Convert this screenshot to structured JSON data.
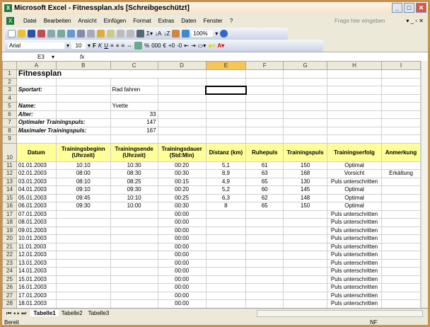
{
  "window": {
    "title": "Microsoft Excel - Fitnessplan.xls  [Schreibgeschützt]"
  },
  "menu": [
    "Datei",
    "Bearbeiten",
    "Ansicht",
    "Einfügen",
    "Format",
    "Extras",
    "Daten",
    "Fenster",
    "?"
  ],
  "help_placeholder": "Frage hier eingeben",
  "toolbar": {
    "zoom": "100%",
    "font": "Arial",
    "size": "10",
    "bold": "F",
    "italic": "K",
    "underline": "U",
    "percent": "%",
    "thousands": "000",
    "euro": "€"
  },
  "formula_bar": {
    "cell_ref": "E3",
    "fx": "fx",
    "value": ""
  },
  "columns": [
    "A",
    "B",
    "C",
    "D",
    "E",
    "F",
    "G",
    "H",
    "I"
  ],
  "selected_column": "E",
  "sheet": {
    "title": "Fitnessplan",
    "sportart_label": "Sportart:",
    "sportart": "Rad fahren",
    "name_label": "Name:",
    "name": "Yvette",
    "alter_label": "Alter:",
    "alter": "33",
    "opt_label": "Optimaler Trainingspuls:",
    "opt": "147",
    "max_label": "Maximaler Trainingspuls:",
    "max": "167",
    "headers": [
      "Datum",
      "Trainingsbeginn (Uhrzeit)",
      "Trainingsende (Uhrzeit)",
      "Trainingsdauer (Std:Min)",
      "Distanz (km)",
      "Ruhepuls",
      "Trainingspuls",
      "Trainingserfolg",
      "Anmerkung"
    ],
    "rows": [
      [
        "01.01.2003",
        "10:10",
        "10:30",
        "00:20",
        "5,1",
        "61",
        "150",
        "Optimal",
        ""
      ],
      [
        "02.01.2003",
        "08:00",
        "08:30",
        "00:30",
        "8,9",
        "63",
        "168",
        "Vorsicht",
        "Erkältung"
      ],
      [
        "03.01.2003",
        "08:10",
        "08:25",
        "00:15",
        "4,9",
        "65",
        "130",
        "Puls unterschritten",
        ""
      ],
      [
        "04.01.2003",
        "09:10",
        "09:30",
        "00:20",
        "5,2",
        "60",
        "145",
        "Optimal",
        ""
      ],
      [
        "05.01.2003",
        "09:45",
        "10:10",
        "00:25",
        "6,3",
        "62",
        "148",
        "Optimal",
        ""
      ],
      [
        "06.01.2003",
        "09:30",
        "10:00",
        "00:30",
        "8",
        "65",
        "150",
        "Optimal",
        ""
      ],
      [
        "07.01.2003",
        "",
        "",
        "00:00",
        "",
        "",
        "",
        "Puls unterschritten",
        ""
      ],
      [
        "08.01.2003",
        "",
        "",
        "00:00",
        "",
        "",
        "",
        "Puls unterschritten",
        ""
      ],
      [
        "09.01.2003",
        "",
        "",
        "00:00",
        "",
        "",
        "",
        "Puls unterschritten",
        ""
      ],
      [
        "10.01.2003",
        "",
        "",
        "00:00",
        "",
        "",
        "",
        "Puls unterschritten",
        ""
      ],
      [
        "11.01.2003",
        "",
        "",
        "00:00",
        "",
        "",
        "",
        "Puls unterschritten",
        ""
      ],
      [
        "12.01.2003",
        "",
        "",
        "00:00",
        "",
        "",
        "",
        "Puls unterschritten",
        ""
      ],
      [
        "13.01.2003",
        "",
        "",
        "00:00",
        "",
        "",
        "",
        "Puls unterschritten",
        ""
      ],
      [
        "14.01.2003",
        "",
        "",
        "00:00",
        "",
        "",
        "",
        "Puls unterschritten",
        ""
      ],
      [
        "15.01.2003",
        "",
        "",
        "00:00",
        "",
        "",
        "",
        "Puls unterschritten",
        ""
      ],
      [
        "16.01.2003",
        "",
        "",
        "00:00",
        "",
        "",
        "",
        "Puls unterschritten",
        ""
      ],
      [
        "17.01.2003",
        "",
        "",
        "00:00",
        "",
        "",
        "",
        "Puls unterschritten",
        ""
      ],
      [
        "18.01.2003",
        "",
        "",
        "00:00",
        "",
        "",
        "",
        "Puls unterschritten",
        ""
      ]
    ]
  },
  "tabs": [
    "Tabelle1",
    "Tabelle2",
    "Tabelle3"
  ],
  "active_tab": "Tabelle1",
  "status": {
    "left": "Bereit",
    "right": "NF"
  }
}
